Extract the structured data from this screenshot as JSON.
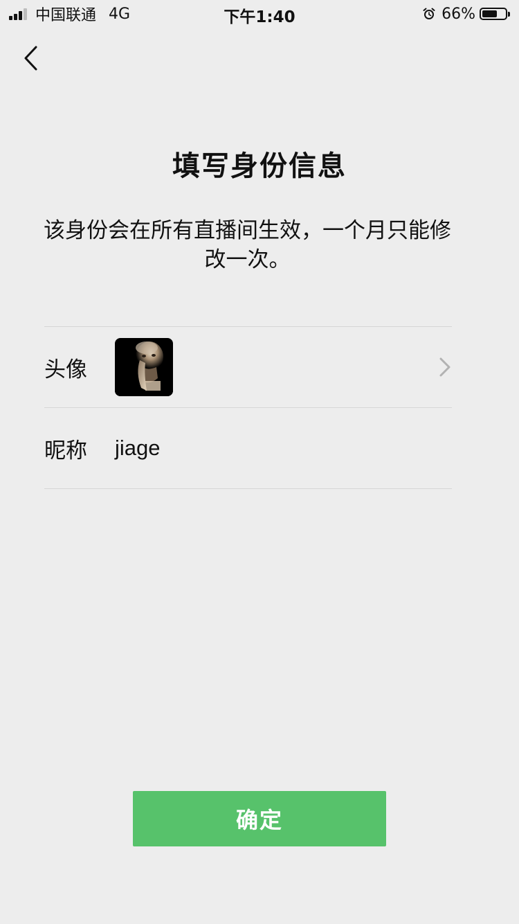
{
  "status_bar": {
    "carrier": "中国联通",
    "network": "4G",
    "time": "下午1:40",
    "battery_percent": "66%",
    "battery_level": 0.66,
    "signal_bars_active": 3,
    "signal_bars_total": 4
  },
  "nav": {
    "back_icon": "chevron-left-icon"
  },
  "page": {
    "title": "填写身份信息",
    "description": "该身份会在所有直播间生效，一个月只能修改一次。"
  },
  "form": {
    "avatar": {
      "label": "头像",
      "image": "avatar-photo",
      "chevron_icon": "chevron-right-icon"
    },
    "nickname": {
      "label": "昵称",
      "value": "jiage"
    }
  },
  "actions": {
    "confirm_label": "确定"
  },
  "colors": {
    "background": "#ededed",
    "primary_button": "#57c26b",
    "divider": "#d6d6d6",
    "chevron": "#b2b2b2"
  }
}
